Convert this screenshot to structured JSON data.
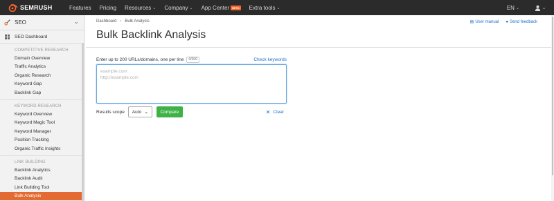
{
  "brand": {
    "name": "SEMRUSH"
  },
  "topnav": {
    "items": [
      {
        "label": "Features",
        "dropdown": false
      },
      {
        "label": "Pricing",
        "dropdown": false
      },
      {
        "label": "Resources",
        "dropdown": true
      },
      {
        "label": "Company",
        "dropdown": true
      },
      {
        "label": "App Center",
        "dropdown": false,
        "badge": "BETA"
      },
      {
        "label": "Extra tools",
        "dropdown": true
      }
    ],
    "language": "EN"
  },
  "sidebar": {
    "tool": "SEO",
    "dashboard": "SEO Dashboard",
    "sections": [
      {
        "title": "COMPETITIVE RESEARCH",
        "items": [
          "Domain Overview",
          "Traffic Analytics",
          "Organic Research",
          "Keyword Gap",
          "Backlink Gap"
        ]
      },
      {
        "title": "KEYWORD RESEARCH",
        "items": [
          "Keyword Overview",
          "Keyword Magic Tool",
          "Keyword Manager",
          "Position Tracking",
          "Organic Traffic Insights"
        ]
      },
      {
        "title": "LINK BUILDING",
        "items": [
          "Backlink Analytics",
          "Backlink Audit",
          "Link Building Tool",
          "Bulk Analysis"
        ]
      }
    ],
    "active_item": "Bulk Analysis"
  },
  "header": {
    "breadcrumb": [
      "Dashboard",
      "Bulk Analysis"
    ],
    "title": "Bulk Backlink Analysis",
    "user_manual": "User manual",
    "send_feedback": "Send feedback"
  },
  "form": {
    "prompt": "Enter up to 200 URLs/domains, one per line",
    "counter": "0/200",
    "check_keywords": "Check keywords",
    "placeholder_line1": "example.com",
    "placeholder_line2": "http://example.com",
    "scope_label": "Results scope",
    "scope_value": "Auto",
    "compare": "Compare",
    "clear": "Clear"
  },
  "colors": {
    "accent": "#ff642d",
    "active": "#e36a33",
    "link": "#1a6fc9",
    "button": "#3fb247",
    "topbar": "#2b2b2b"
  }
}
